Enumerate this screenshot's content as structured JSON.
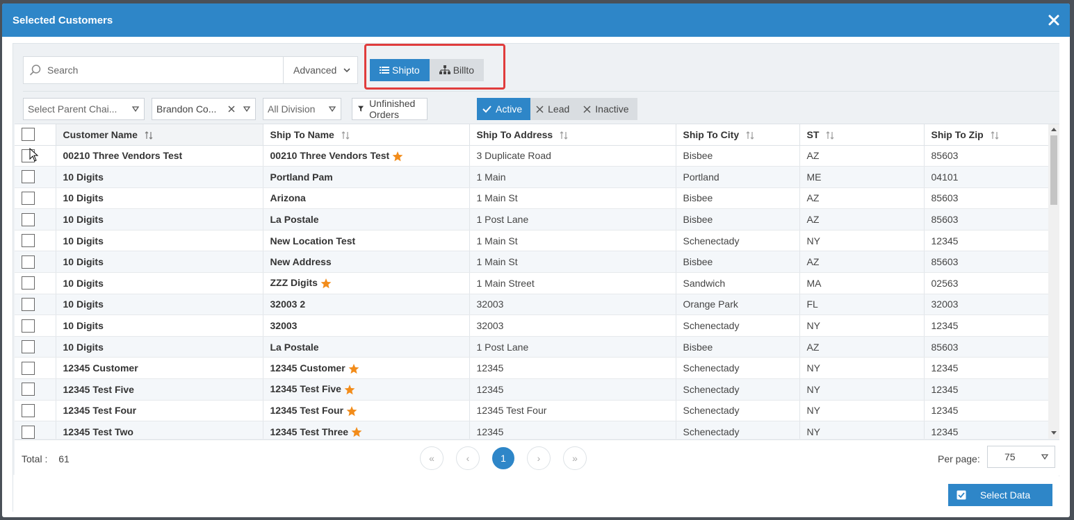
{
  "modal": {
    "title": "Selected Customers"
  },
  "search": {
    "placeholder": "Search",
    "advanced_label": "Advanced"
  },
  "view_toggle": {
    "shipto_label": "Shipto",
    "billto_label": "Billto"
  },
  "filters": {
    "parent_chain": "Select Parent Chai...",
    "brandon": "Brandon Co...",
    "division": "All Division",
    "unfinished": "Unfinished Orders"
  },
  "status": {
    "active": "Active",
    "lead": "Lead",
    "inactive": "Inactive"
  },
  "table": {
    "headers": [
      "Customer Name",
      "Ship To Name",
      "Ship To Address",
      "Ship To City",
      "ST",
      "Ship To Zip"
    ],
    "rows": [
      {
        "customer": "00210 Three Vendors Test",
        "ship_name": "00210 Three Vendors Test",
        "star": true,
        "address": "3 Duplicate Road",
        "city": "Bisbee",
        "st": "AZ",
        "zip": "85603"
      },
      {
        "customer": "10 Digits",
        "ship_name": "Portland Pam",
        "star": false,
        "address": "1 Main",
        "city": "Portland",
        "st": "ME",
        "zip": "04101"
      },
      {
        "customer": "10 Digits",
        "ship_name": "Arizona",
        "star": false,
        "address": "1 Main St",
        "city": "Bisbee",
        "st": "AZ",
        "zip": "85603"
      },
      {
        "customer": "10 Digits",
        "ship_name": "La Postale",
        "star": false,
        "address": "1 Post Lane",
        "city": "Bisbee",
        "st": "AZ",
        "zip": "85603"
      },
      {
        "customer": "10 Digits",
        "ship_name": "New Location Test",
        "star": false,
        "address": "1 Main St",
        "city": "Schenectady",
        "st": "NY",
        "zip": "12345"
      },
      {
        "customer": "10 Digits",
        "ship_name": "New Address",
        "star": false,
        "address": "1 Main St",
        "city": "Bisbee",
        "st": "AZ",
        "zip": "85603"
      },
      {
        "customer": "10 Digits",
        "ship_name": "ZZZ Digits",
        "star": true,
        "address": "1 Main Street",
        "city": "Sandwich",
        "st": "MA",
        "zip": "02563"
      },
      {
        "customer": "10 Digits",
        "ship_name": "32003 2",
        "star": false,
        "address": "32003",
        "city": "Orange Park",
        "st": "FL",
        "zip": "32003"
      },
      {
        "customer": "10 Digits",
        "ship_name": "32003",
        "star": false,
        "address": "32003",
        "city": "Schenectady",
        "st": "NY",
        "zip": "12345"
      },
      {
        "customer": "10 Digits",
        "ship_name": "La Postale",
        "star": false,
        "address": "1 Post Lane",
        "city": "Bisbee",
        "st": "AZ",
        "zip": "85603"
      },
      {
        "customer": "12345 Customer",
        "ship_name": "12345 Customer",
        "star": true,
        "address": "12345",
        "city": "Schenectady",
        "st": "NY",
        "zip": "12345"
      },
      {
        "customer": "12345 Test Five",
        "ship_name": "12345 Test Five",
        "star": true,
        "address": "12345",
        "city": "Schenectady",
        "st": "NY",
        "zip": "12345"
      },
      {
        "customer": "12345 Test Four",
        "ship_name": "12345 Test Four",
        "star": true,
        "address": "12345 Test Four",
        "city": "Schenectady",
        "st": "NY",
        "zip": "12345"
      },
      {
        "customer": "12345 Test Two",
        "ship_name": "12345 Test Three",
        "star": true,
        "address": "12345",
        "city": "Schenectady",
        "st": "NY",
        "zip": "12345"
      }
    ]
  },
  "footer": {
    "total_label": "Total :",
    "total_value": "61",
    "pager": {
      "first": "«",
      "prev": "‹",
      "current": "1",
      "next": "›",
      "last": "»"
    },
    "per_page_label": "Per page:",
    "per_page_value": "75"
  },
  "actions": {
    "select_data": "Select Data"
  },
  "colors": {
    "primary": "#2e86c8",
    "highlight": "#e03c3c",
    "star": "#f28c1a"
  }
}
